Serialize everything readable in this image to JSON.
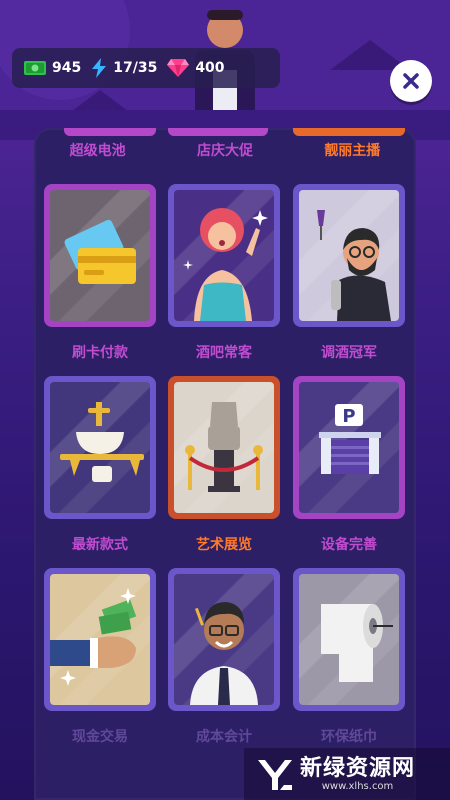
{
  "hud": {
    "cash": "945",
    "energy": "17/35",
    "gems": "400"
  },
  "top_row_labels": [
    "超级电池",
    "店庆大促",
    "靓丽主播"
  ],
  "cards": [
    {
      "label": "刷卡付款",
      "icon": "credit-card-icon",
      "state": "owned"
    },
    {
      "label": "酒吧常客",
      "icon": "bar-regular-woman-icon",
      "state": "normal"
    },
    {
      "label": "调酒冠军",
      "icon": "bartender-champion-icon",
      "state": "normal"
    },
    {
      "label": "最新款式",
      "icon": "sink-icon",
      "state": "normal"
    },
    {
      "label": "艺术展览",
      "icon": "art-statue-icon",
      "state": "highlight"
    },
    {
      "label": "设备完善",
      "icon": "parking-garage-icon",
      "state": "owned"
    },
    {
      "label": "现金交易",
      "icon": "cash-hand-icon",
      "state": "normal"
    },
    {
      "label": "成本会计",
      "icon": "accountant-icon",
      "state": "normal"
    },
    {
      "label": "环保纸巾",
      "icon": "toilet-paper-icon",
      "state": "normal"
    }
  ],
  "watermark": {
    "title": "新绿资源网",
    "url": "www.xlhs.com"
  },
  "colors": {
    "purple_label": "#c04ccf",
    "orange_label": "#ff7a2a",
    "panel": "#2d1f66"
  }
}
